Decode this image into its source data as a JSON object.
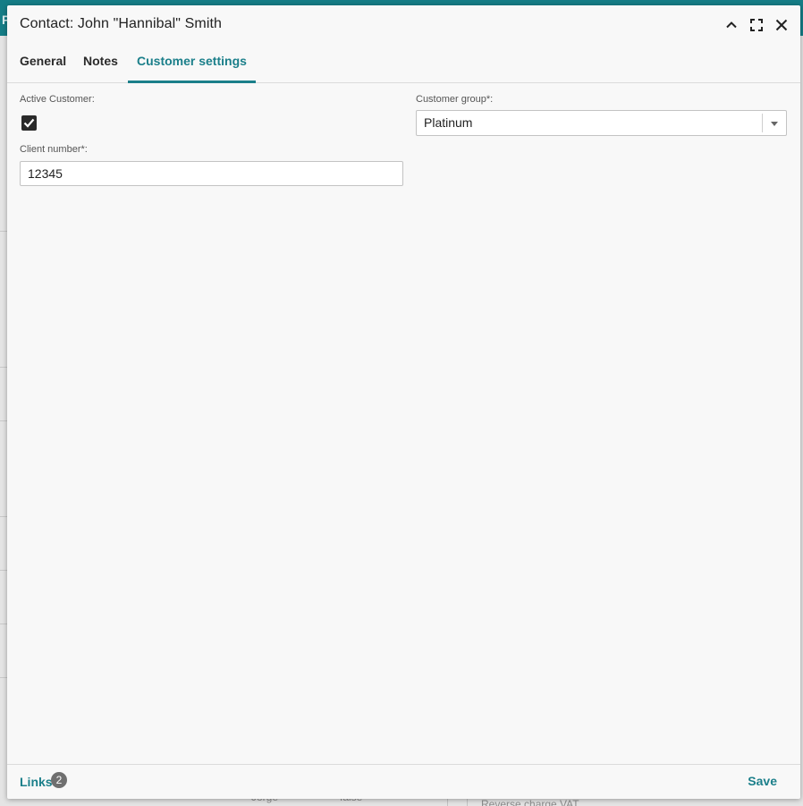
{
  "background": {
    "app_letter": "P",
    "row_text_1": "Jorge",
    "row_text_2": "false",
    "row_text_3": "Reverse charge VAT"
  },
  "dialog": {
    "title": "Contact: John \"Hannibal\" Smith",
    "header_icons": [
      "chevron-up-icon",
      "fullscreen-icon",
      "close-icon"
    ],
    "tabs": [
      {
        "label": "General",
        "active": false
      },
      {
        "label": "Notes",
        "active": false
      },
      {
        "label": "Customer settings",
        "active": true
      }
    ],
    "fields": {
      "active_customer": {
        "label": "Active Customer:",
        "checked": true
      },
      "client_number": {
        "label": "Client number*:",
        "value": "12345"
      },
      "customer_group": {
        "label": "Customer group*:",
        "value": "Platinum"
      }
    },
    "footer": {
      "links_label": "Links",
      "links_count": "2",
      "save_label": "Save"
    }
  },
  "colors": {
    "accent": "#1b7f8a",
    "topbar": "#157d86",
    "checkbox": "#2a2a2a",
    "badge": "#6f6f6f"
  }
}
